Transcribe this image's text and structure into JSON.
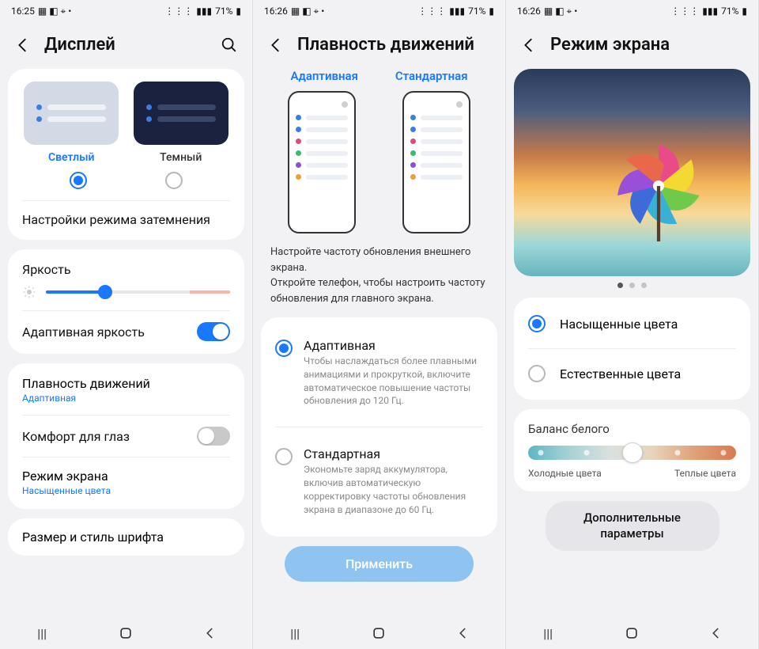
{
  "panes": [
    {
      "statusbar": {
        "time": "16:25",
        "battery": "71%"
      },
      "title": "Дисплей",
      "theme": {
        "light": "Светлый",
        "dark": "Темный",
        "darkmode_settings": "Настройки режима затемнения"
      },
      "brightness": {
        "title": "Яркость",
        "value_pct": 32
      },
      "adaptive_brightness": {
        "label": "Адаптивная яркость",
        "on": true
      },
      "motion": {
        "label": "Плавность движений",
        "value": "Адаптивная"
      },
      "eye_comfort": {
        "label": "Комфорт для глаз",
        "on": false
      },
      "screen_mode": {
        "label": "Режим экрана",
        "value": "Насыщенные цвета"
      },
      "font": {
        "label": "Размер и стиль шрифта"
      }
    },
    {
      "statusbar": {
        "time": "16:26",
        "battery": "71%"
      },
      "title": "Плавность движений",
      "headers": {
        "adaptive": "Адаптивная",
        "standard": "Стандартная"
      },
      "description": "Настройте частоту обновления внешнего экрана.\nОткройте телефон, чтобы настроить частоту обновления для главного экрана.",
      "opt_adaptive": {
        "title": "Адаптивная",
        "desc": "Чтобы наслаждаться более плавными анимациями и прокруткой, включите автоматическое повышение частоты обновления до 120 Гц."
      },
      "opt_standard": {
        "title": "Стандартная",
        "desc": "Экономьте заряд аккумулятора, включив автоматическую корректировку частоты обновления экрана в диапазоне до 60 Гц."
      },
      "apply": "Применить"
    },
    {
      "statusbar": {
        "time": "16:26",
        "battery": "71%"
      },
      "title": "Режим экрана",
      "mode_vivid": "Насыщенные цвета",
      "mode_natural": "Естественные цвета",
      "white_balance": {
        "title": "Баланс белого",
        "cold": "Холодные цвета",
        "warm": "Теплые цвета",
        "value_pct": 50
      },
      "more": "Дополнительные параметры"
    }
  ]
}
